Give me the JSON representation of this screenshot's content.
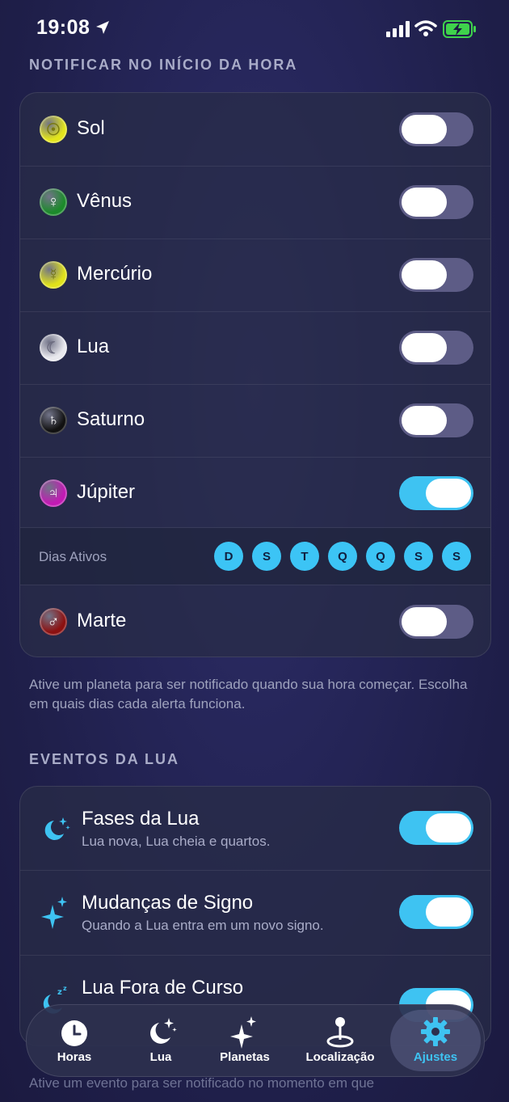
{
  "status_bar": {
    "time": "19:08"
  },
  "section_hours": {
    "title": "NOTIFICAR NO INÍCIO DA HORA",
    "planets": [
      {
        "name": "Sol",
        "glyph": "☉",
        "color": "#e3e51b",
        "glyph_color": "#7a7a10",
        "on": false
      },
      {
        "name": "Vênus",
        "glyph": "♀",
        "color": "#1c8a2b",
        "glyph_color": "#ffffff",
        "on": false
      },
      {
        "name": "Mercúrio",
        "glyph": "☿",
        "color": "#e0e21a",
        "glyph_color": "#6d6d10",
        "on": false
      },
      {
        "name": "Lua",
        "glyph": "☾",
        "color": "#e9e9ee",
        "glyph_color": "#6d6d80",
        "on": false
      },
      {
        "name": "Saturno",
        "glyph": "♄",
        "color": "#111111",
        "glyph_color": "#ffffff",
        "on": false
      },
      {
        "name": "Júpiter",
        "glyph": "♃",
        "color": "#c21ab4",
        "glyph_color": "#ffffff",
        "on": true
      }
    ],
    "active_days_label": "Dias Ativos",
    "days": [
      "D",
      "S",
      "T",
      "Q",
      "Q",
      "S",
      "S"
    ],
    "last_planet": {
      "name": "Marte",
      "glyph": "♂",
      "color": "#8c1111",
      "glyph_color": "#ffffff",
      "on": false
    },
    "footnote": "Ative um planeta para ser notificado quando sua hora começar. Escolha em quais dias cada alerta funciona."
  },
  "section_moon": {
    "title": "EVENTOS DA LUA",
    "events": [
      {
        "title": "Fases da Lua",
        "subtitle": "Lua nova, Lua cheia e quartos.",
        "on": true,
        "icon": "moon-stars-icon"
      },
      {
        "title": "Mudanças de Signo",
        "subtitle": "Quando a Lua entra em um novo signo.",
        "on": true,
        "icon": "sparkles-icon"
      },
      {
        "title": "Lua Fora de Curso",
        "subtitle": "",
        "on": true,
        "icon": "moon-zzz-icon"
      }
    ],
    "footnote_partial": "Ative um evento para ser notificado no momento em que"
  },
  "tabbar": {
    "tabs": [
      {
        "label": "Horas",
        "icon": "clock-icon"
      },
      {
        "label": "Lua",
        "icon": "moon-stars-icon"
      },
      {
        "label": "Planetas",
        "icon": "sparkles-icon"
      },
      {
        "label": "Localização",
        "icon": "location-pin-icon"
      },
      {
        "label": "Ajustes",
        "icon": "gear-icon",
        "active": true
      }
    ]
  },
  "colors": {
    "accent": "#3ec3f2",
    "toggle_off": "#5d5c86"
  }
}
